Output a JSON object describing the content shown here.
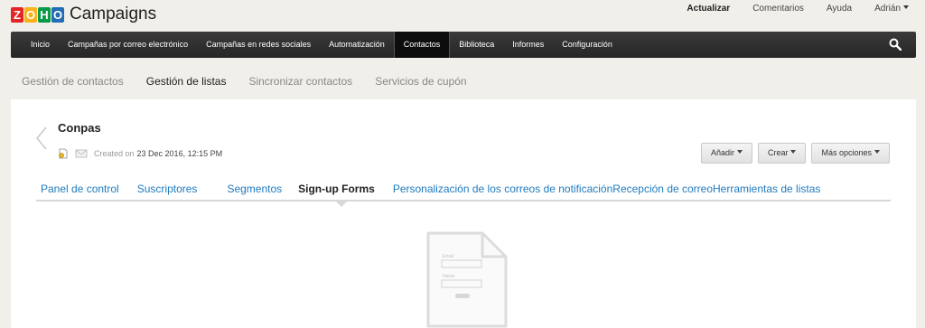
{
  "header": {
    "logo_letters": [
      "Z",
      "O",
      "H",
      "O"
    ],
    "logo_colors": [
      "#e42527",
      "#f9b21d",
      "#089949",
      "#226db4"
    ],
    "app_name": "Campaigns",
    "links": {
      "upgrade": "Actualizar",
      "feedback": "Comentarios",
      "help": "Ayuda",
      "user": "Adrián"
    }
  },
  "navbar": {
    "items": [
      {
        "label": "Inicio"
      },
      {
        "label": "Campañas por correo electrónico"
      },
      {
        "label": "Campañas en redes sociales"
      },
      {
        "label": "Automatización"
      },
      {
        "label": "Contactos",
        "active": true
      },
      {
        "label": "Biblioteca"
      },
      {
        "label": "Informes"
      },
      {
        "label": "Configuración"
      }
    ]
  },
  "subnav": {
    "items": [
      {
        "label": "Gestión de contactos"
      },
      {
        "label": "Gestión de listas",
        "active": true
      },
      {
        "label": "Sincronizar contactos"
      },
      {
        "label": "Servicios de cupón"
      }
    ]
  },
  "list": {
    "name": "Conpas",
    "created_prefix": "Created on",
    "created_date": "23 Dec 2016, 12:15 PM"
  },
  "actions": {
    "add": "Añadir",
    "create": "Crear",
    "more": "Más opciones"
  },
  "tabs": [
    {
      "label": "Panel de control"
    },
    {
      "label": "Suscriptores"
    },
    {
      "label": "Segmentos"
    },
    {
      "label": "Sign-up Forms",
      "active": true
    },
    {
      "label": "Personalización de los correos de notificación"
    },
    {
      "label": "Recepción de correo"
    },
    {
      "label": "Herramientas de listas"
    }
  ],
  "illustration": {
    "email_label": "Email",
    "name_label": "Name"
  },
  "colors": {
    "accent_link": "#1f7bbf",
    "navbar": "#2b2b2b",
    "background": "#f1efea"
  }
}
